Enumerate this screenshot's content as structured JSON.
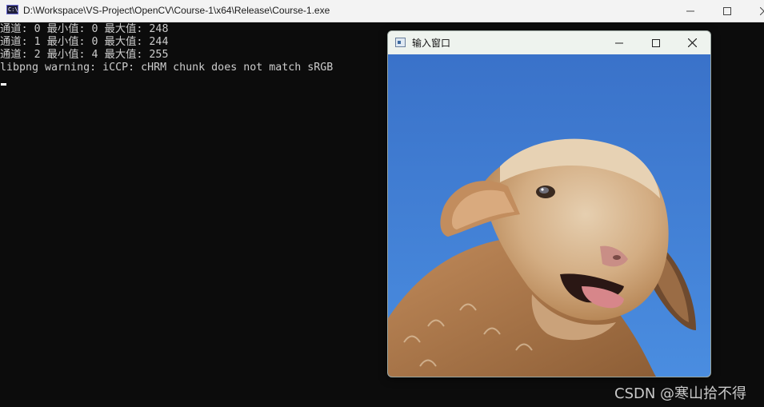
{
  "console": {
    "title": "D:\\Workspace\\VS-Project\\OpenCV\\Course-1\\x64\\Release\\Course-1.exe",
    "icon_label": "C:\\",
    "lines": [
      "通道: 0 最小值: 0 最大值: 248",
      "通道: 1 最小值: 0 最大值: 244",
      "通道: 2 最小值: 4 最大值: 255",
      "libpng warning: iCCP: cHRM chunk does not match sRGB"
    ]
  },
  "image_window": {
    "title": "输入窗口",
    "content": "sheep-photo"
  },
  "watermark": "CSDN @寒山拾不得",
  "colors": {
    "console_bg": "#0c0c0c",
    "console_text": "#cccccc",
    "titlebar": "#f3f3f3",
    "sky": "#3f7fd4",
    "wool": "#c79a6b"
  }
}
